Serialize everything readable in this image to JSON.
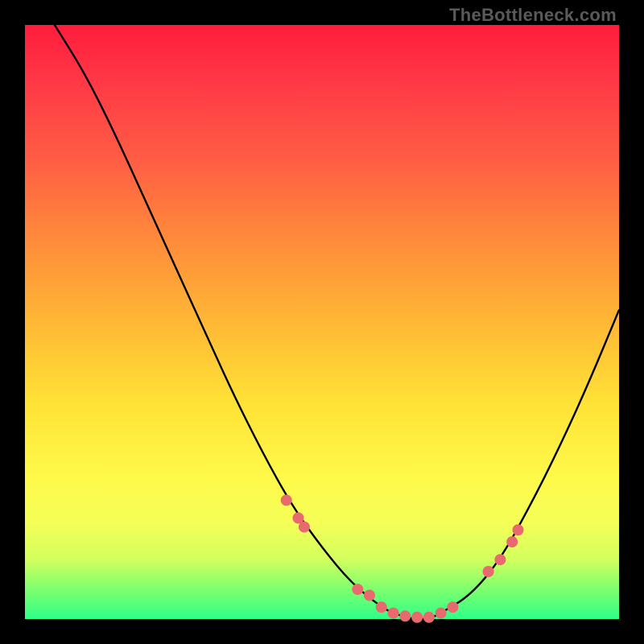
{
  "credit_text": "TheBottleneck.com",
  "chart_data": {
    "type": "line",
    "title": "",
    "xlabel": "",
    "ylabel": "",
    "xlim": [
      0,
      100
    ],
    "ylim": [
      0,
      100
    ],
    "series": [
      {
        "name": "bottleneck-curve",
        "x": [
          5,
          10,
          15,
          20,
          25,
          30,
          35,
          40,
          45,
          50,
          55,
          60,
          62,
          65,
          68,
          70,
          75,
          80,
          85,
          90,
          95,
          100
        ],
        "values": [
          100,
          92,
          82,
          71,
          60,
          49,
          38,
          28,
          19,
          12,
          6,
          2,
          1,
          0,
          0,
          1,
          4,
          10,
          19,
          29,
          40,
          52
        ]
      }
    ],
    "markers": {
      "name": "highlight-dots",
      "x": [
        44,
        46,
        47,
        56,
        58,
        60,
        62,
        64,
        66,
        68,
        70,
        72,
        78,
        80,
        82,
        83
      ],
      "values": [
        20,
        17,
        15.5,
        5,
        4,
        2,
        1,
        0.5,
        0.3,
        0.3,
        1,
        2,
        8,
        10,
        13,
        15
      ]
    },
    "gradient_stops": [
      {
        "pos": 0,
        "color": "#ff1c3c"
      },
      {
        "pos": 22,
        "color": "#ff5b45"
      },
      {
        "pos": 50,
        "color": "#ffb836"
      },
      {
        "pos": 76,
        "color": "#fff94a"
      },
      {
        "pos": 95,
        "color": "#7dff6e"
      },
      {
        "pos": 100,
        "color": "#2fff88"
      }
    ]
  }
}
